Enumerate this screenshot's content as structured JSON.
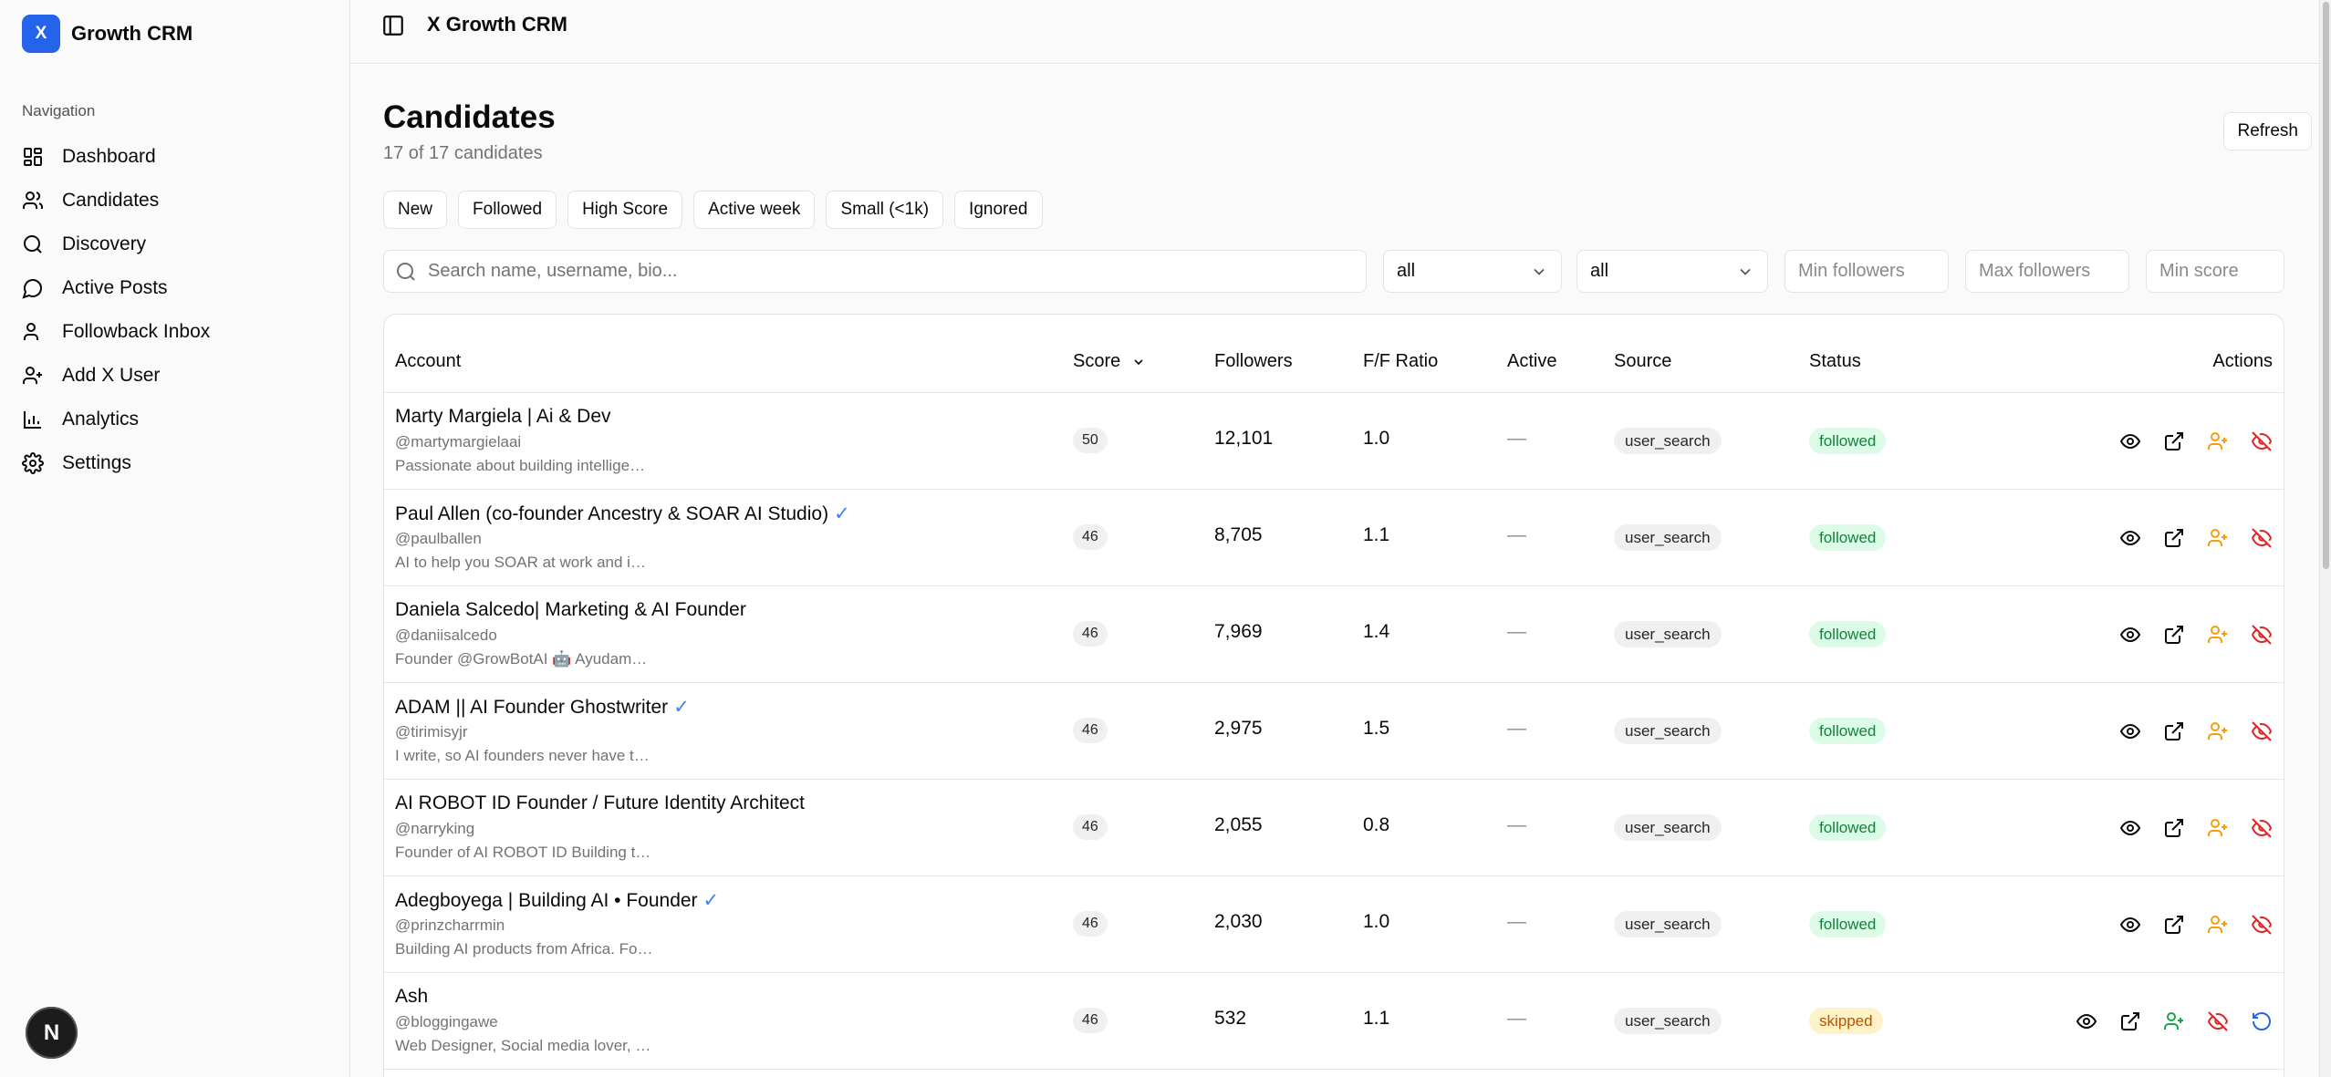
{
  "brand": {
    "logo_letter": "X",
    "name": "Growth CRM",
    "accent": "#2563eb"
  },
  "sidebar": {
    "heading": "Navigation",
    "items": [
      {
        "label": "Dashboard",
        "icon": "dashboard-icon"
      },
      {
        "label": "Candidates",
        "icon": "users-icon"
      },
      {
        "label": "Discovery",
        "icon": "search-icon"
      },
      {
        "label": "Active Posts",
        "icon": "message-circle-icon"
      },
      {
        "label": "Followback Inbox",
        "icon": "user-icon"
      },
      {
        "label": "Add X User",
        "icon": "user-plus-icon"
      },
      {
        "label": "Analytics",
        "icon": "bar-chart-icon"
      },
      {
        "label": "Settings",
        "icon": "gear-icon"
      }
    ],
    "devtools_badge": "N"
  },
  "topbar": {
    "title": "X Growth CRM"
  },
  "page": {
    "title": "Candidates",
    "subtitle": "17 of 17 candidates",
    "refresh_label": "Refresh"
  },
  "chips": [
    "New",
    "Followed",
    "High Score",
    "Active week",
    "Small (<1k)",
    "Ignored"
  ],
  "filters": {
    "search_placeholder": "Search name, username, bio...",
    "select1_value": "all",
    "select2_value": "all",
    "min_followers_placeholder": "Min followers",
    "max_followers_placeholder": "Max followers",
    "min_score_placeholder": "Min score"
  },
  "table": {
    "columns": {
      "account": "Account",
      "score": "Score",
      "followers": "Followers",
      "ratio": "F/F Ratio",
      "active": "Active",
      "source": "Source",
      "status": "Status",
      "actions": "Actions"
    },
    "rows": [
      {
        "name": "Marty Margiela | Ai & Dev",
        "verified": "",
        "username": "@martymargielaai",
        "bio": "Passionate about building intellige…",
        "score": "50",
        "followers": "12,101",
        "ratio": "1.0",
        "active": "—",
        "source": "user_search",
        "status": "followed"
      },
      {
        "name": "Paul Allen (co-founder Ancestry & SOAR AI Studio)",
        "verified": "✓",
        "username": "@paulballen",
        "bio": "AI to help you SOAR at work and i…",
        "score": "46",
        "followers": "8,705",
        "ratio": "1.1",
        "active": "—",
        "source": "user_search",
        "status": "followed"
      },
      {
        "name": "Daniela Salcedo| Marketing & AI Founder",
        "verified": "",
        "username": "@daniisalcedo",
        "bio": "Founder @GrowBotAI 🤖 Ayudam…",
        "score": "46",
        "followers": "7,969",
        "ratio": "1.4",
        "active": "—",
        "source": "user_search",
        "status": "followed"
      },
      {
        "name": "ADAM || AI Founder Ghostwriter",
        "verified": "✓",
        "username": "@tirimisyjr",
        "bio": "I write, so AI founders never have t…",
        "score": "46",
        "followers": "2,975",
        "ratio": "1.5",
        "active": "—",
        "source": "user_search",
        "status": "followed"
      },
      {
        "name": "AI ROBOT ID Founder / Future Identity Architect",
        "verified": "",
        "username": "@narryking",
        "bio": "Founder of AI ROBOT ID Building t…",
        "score": "46",
        "followers": "2,055",
        "ratio": "0.8",
        "active": "—",
        "source": "user_search",
        "status": "followed"
      },
      {
        "name": "Adegboyega | Building AI • Founder",
        "verified": "✓",
        "username": "@prinzcharrmin",
        "bio": "Building AI products from Africa. Fo…",
        "score": "46",
        "followers": "2,030",
        "ratio": "1.0",
        "active": "—",
        "source": "user_search",
        "status": "followed"
      },
      {
        "name": "Ash",
        "verified": "",
        "username": "@bloggingawe",
        "bio": "Web Designer, Social media lover, …",
        "score": "46",
        "followers": "532",
        "ratio": "1.1",
        "active": "—",
        "source": "user_search",
        "status": "skipped"
      }
    ]
  },
  "colors": {
    "followed_bg": "#dcfce7",
    "followed_text": "#15803d",
    "skipped_bg": "#fef3c7",
    "skipped_text": "#b45309",
    "follow_action": "#f59e0b",
    "ignore_action": "#dc2626",
    "restore_action": "#2563eb"
  }
}
